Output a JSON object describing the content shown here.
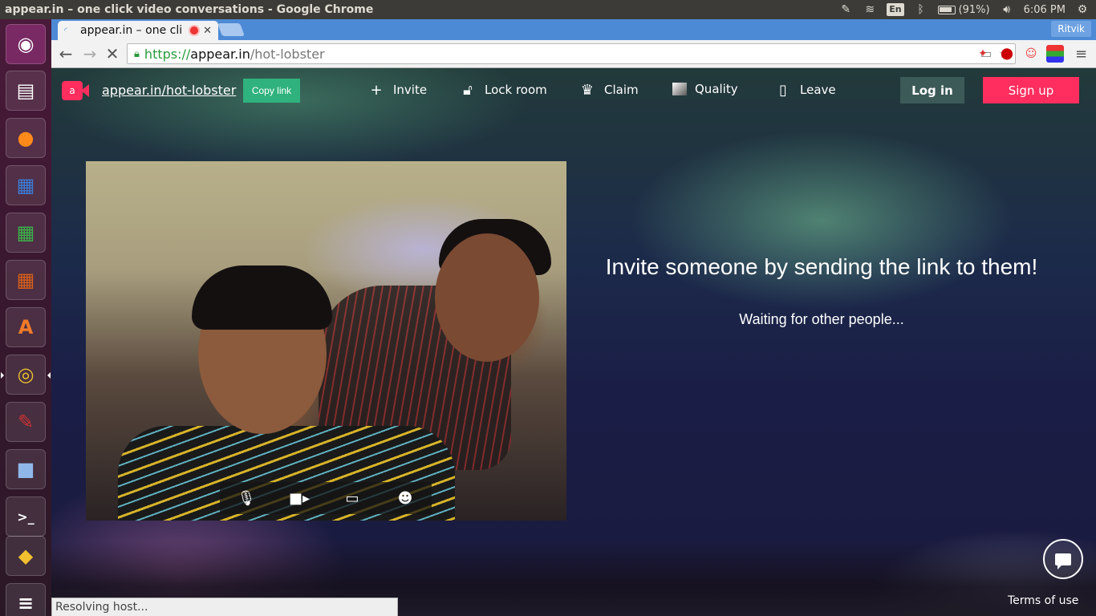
{
  "window": {
    "title": "appear.in – one click video conversations - Google Chrome",
    "keyboard_layout": "En",
    "battery": "(91%)",
    "clock": "6:06 PM"
  },
  "launcher": {
    "items": [
      {
        "name": "ubuntu-dash",
        "glyph": "◉"
      },
      {
        "name": "files",
        "glyph": "▤"
      },
      {
        "name": "firefox",
        "glyph": "●"
      },
      {
        "name": "libreoffice-writer",
        "glyph": "▦"
      },
      {
        "name": "libreoffice-calc",
        "glyph": "▦"
      },
      {
        "name": "libreoffice-impress",
        "glyph": "▦"
      },
      {
        "name": "ubuntu-software-center",
        "glyph": "A"
      },
      {
        "name": "chrome",
        "glyph": "◎"
      },
      {
        "name": "system-settings",
        "glyph": "✎"
      },
      {
        "name": "virtualbox",
        "glyph": "■"
      },
      {
        "name": "terminal",
        "glyph": ">_"
      },
      {
        "name": "wine",
        "glyph": "◆"
      },
      {
        "name": "workspace-switcher",
        "glyph": "≡"
      }
    ]
  },
  "browser": {
    "tab_title": "appear.in – one cli",
    "profile_name": "Ritvik",
    "url_scheme": "https://",
    "url_host": "appear.in",
    "url_path": "/hot-lobster",
    "status_text": "Resolving host..."
  },
  "appbar": {
    "room_link": "appear.in/hot-lobster",
    "copy_link": "Copy link",
    "invite": "Invite",
    "lock_room": "Lock room",
    "claim": "Claim",
    "quality": "Quality",
    "leave": "Leave",
    "login": "Log in",
    "signup": "Sign up"
  },
  "main": {
    "invite_heading": "Invite someone by sending the link to them!",
    "waiting_text": "Waiting for other people...",
    "terms": "Terms of use"
  },
  "colors": {
    "brand_pink": "#ff2e5f",
    "copy_green": "#2fb27d",
    "login_bg": "#3c5a58",
    "chrome_blue": "#4d8ad6"
  }
}
